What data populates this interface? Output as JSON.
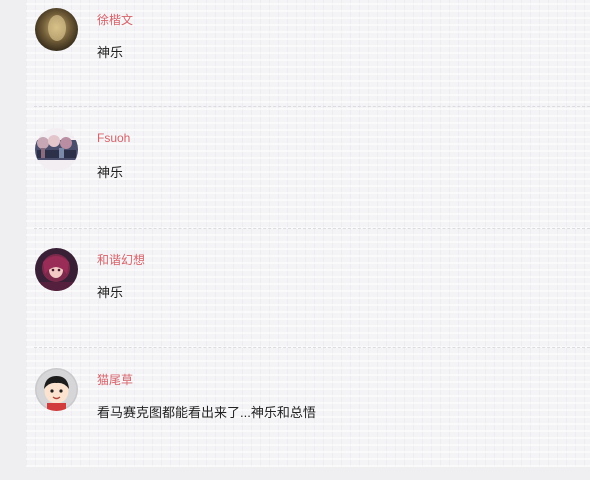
{
  "comments": [
    {
      "username": "徐楷文",
      "text": "神乐",
      "avatar_icon": "user-avatar-brown-icon"
    },
    {
      "username": "Fsuoh",
      "text": "神乐",
      "avatar_icon": "user-avatar-anime-group-icon"
    },
    {
      "username": "和谐幻想",
      "text": "神乐",
      "avatar_icon": "user-avatar-anime-girl-icon"
    },
    {
      "username": "猫尾草",
      "text": "看马赛克图都能看出来了...神乐和总悟",
      "avatar_icon": "user-avatar-cartoon-boy-icon"
    }
  ],
  "colors": {
    "username": "#d4646b",
    "text": "#222222",
    "separator": "#dcdbe0"
  }
}
